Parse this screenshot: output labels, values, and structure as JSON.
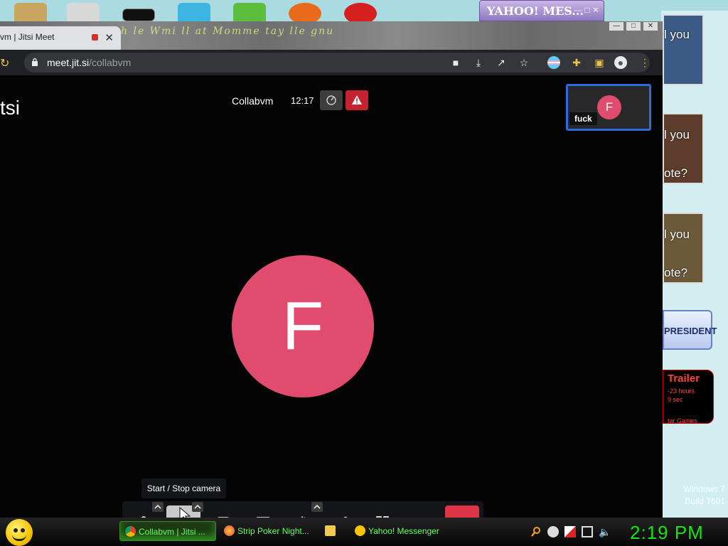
{
  "desktop": {
    "yahoo_window_title": "YAHOO! MES...",
    "side_panel": {
      "texts": [
        "l you",
        "l you",
        "ote?",
        "l you",
        "ote?"
      ],
      "president_label": "PRESIDENT",
      "trailer_label": "Trailer",
      "trailer_line1": "-23 hours",
      "trailer_line2": "9 sec",
      "trailer_line3": "tar Games"
    },
    "windows_version_line1": "Windows 7",
    "windows_version_line2": "Build 7601"
  },
  "browser": {
    "tab_title": "vm | Jitsi Meet",
    "url_host": "meet.jit.si",
    "url_path": "/collabvm",
    "graffiti_text": "h le Wmi ll at Momme tay lle gnu"
  },
  "meet": {
    "brand_partial": "tsi",
    "room_name": "Collabvm",
    "timer": "12:17",
    "thumbnail": {
      "initial": "F",
      "name": "fuck"
    },
    "main_avatar_initial": "F",
    "tooltip": "Start / Stop camera",
    "accent_colors": {
      "avatar": "#e14b6e",
      "hangup": "#dd3447",
      "warning": "#c5232d",
      "thumb_border": "#2b6bdc"
    }
  },
  "taskbar": {
    "items": [
      {
        "label": "Collabvm | Jitsi ...",
        "icon": "chrome-icon"
      },
      {
        "label": "Strip Poker Night...",
        "icon": "firefox-icon"
      },
      {
        "label": "",
        "icon": "folder-icon"
      },
      {
        "label": "Yahoo! Messenger",
        "icon": "yahoo-smiley-icon"
      }
    ],
    "clock": "2:19 PM"
  }
}
